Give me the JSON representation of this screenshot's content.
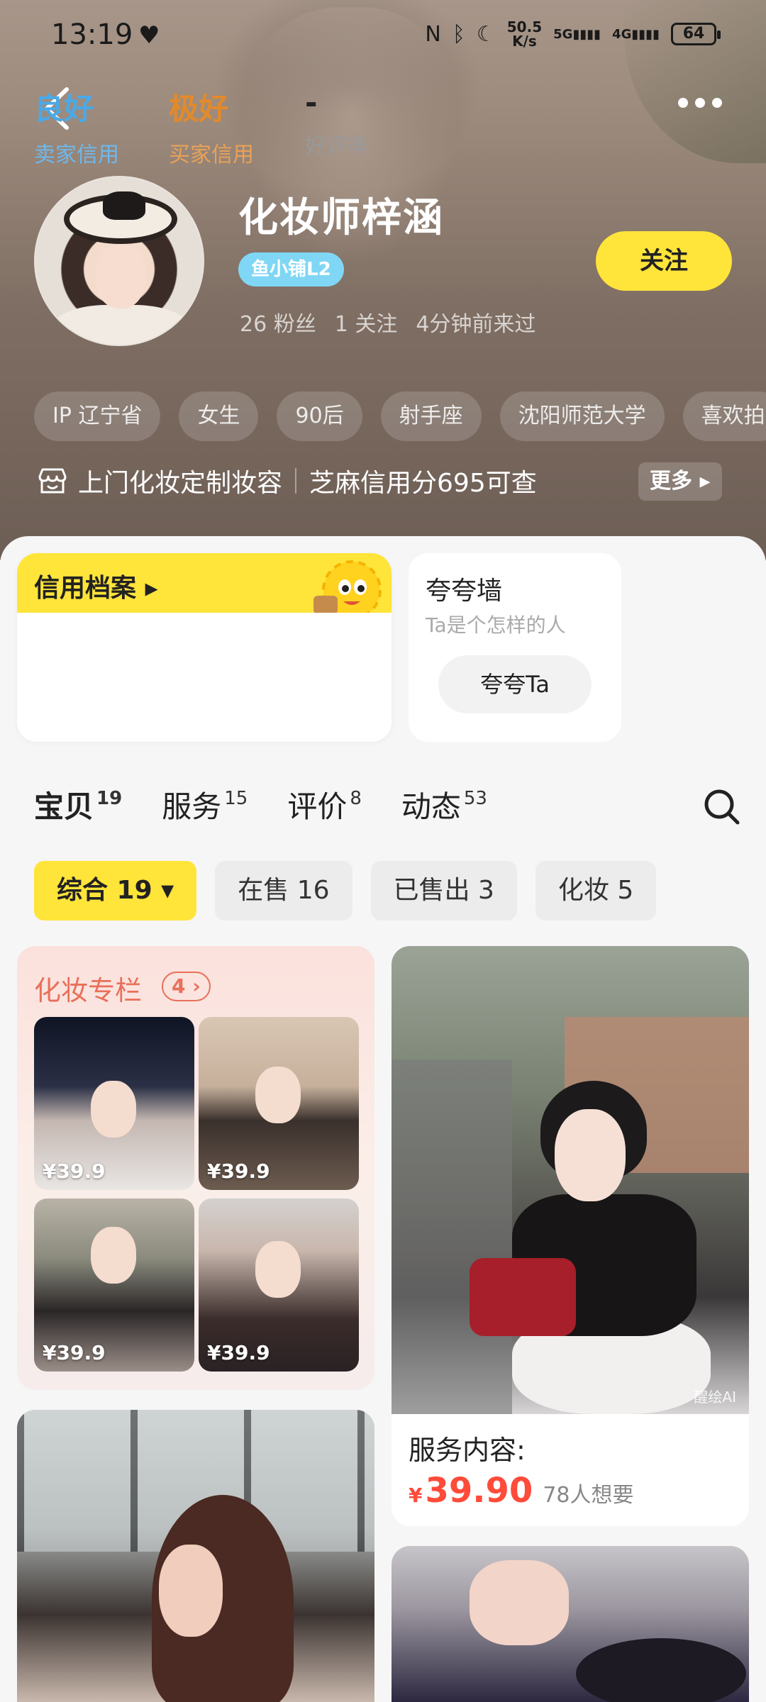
{
  "status_bar": {
    "time": "13:19",
    "net_speed_top": "50.5",
    "net_speed_bottom": "K/s",
    "sig1": "5G",
    "sig2": "4G",
    "battery": "64"
  },
  "profile": {
    "name": "化妆师梓涵",
    "shop_badge": "鱼小铺L2",
    "fans": "26 粉丝",
    "following": "1 关注",
    "last_seen": "4分钟前来过",
    "follow_label": "关注"
  },
  "tags": [
    "IP 辽宁省",
    "女生",
    "90后",
    "射手座",
    "沈阳师范大学",
    "喜欢拍"
  ],
  "bio": {
    "text": "上门化妆定制妆容",
    "credit_text": "芝麻信用分695可查",
    "more_label": "更多 ▸"
  },
  "credit": {
    "title": "信用档案 ▸",
    "items": [
      {
        "value": "良好",
        "label": "卖家信用",
        "color": "#4aa9e8"
      },
      {
        "value": "极好",
        "label": "买家信用",
        "color": "#e28a2b"
      },
      {
        "value": "-",
        "label": "好评率",
        "color": "#222222"
      }
    ]
  },
  "praise": {
    "title": "夸夸墙",
    "subtitle": "Ta是个怎样的人",
    "button": "夸夸Ta"
  },
  "tabs": [
    {
      "label": "宝贝",
      "count": "19"
    },
    {
      "label": "服务",
      "count": "15"
    },
    {
      "label": "评价",
      "count": "8"
    },
    {
      "label": "动态",
      "count": "53"
    }
  ],
  "filters": [
    "综合 19 ▾",
    "在售 16",
    "已售出 3",
    "化妆 5"
  ],
  "column": {
    "title": "化妆专栏",
    "count": "4 ›",
    "prices": [
      "¥39.9",
      "¥39.9",
      "¥39.9",
      "¥39.9"
    ]
  },
  "product": {
    "title": "服务内容:",
    "price_symbol": "¥",
    "price": "39.90",
    "wants": "78人想要",
    "watermark": "醒绘AI"
  },
  "colors": {
    "accent_yellow": "#ffe43a",
    "price_red": "#ff4b3a",
    "column_orange": "#e9705a"
  }
}
